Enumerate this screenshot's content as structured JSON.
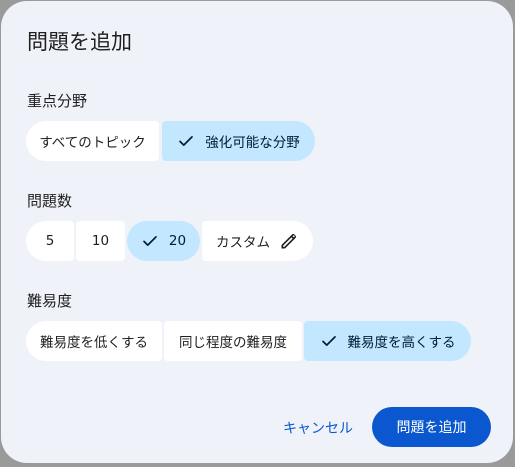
{
  "dialog": {
    "title": "問題を追加",
    "focus": {
      "label": "重点分野",
      "options": [
        "すべてのトピック",
        "強化可能な分野"
      ],
      "selected": "強化可能な分野"
    },
    "count": {
      "label": "問題数",
      "options": [
        "5",
        "10",
        "20",
        "カスタム"
      ],
      "selected": "20"
    },
    "difficulty": {
      "label": "難易度",
      "options": [
        "難易度を低くする",
        "同じ程度の難易度",
        "難易度を高くする"
      ],
      "selected": "難易度を高くする"
    },
    "actions": {
      "cancel": "キャンセル",
      "confirm": "問題を追加"
    }
  },
  "colors": {
    "selected_chip": "#c2e7ff",
    "primary": "#0b57d0",
    "surface": "#eff3f9"
  },
  "icons": {
    "selected": "check-icon",
    "custom": "pencil-icon"
  }
}
